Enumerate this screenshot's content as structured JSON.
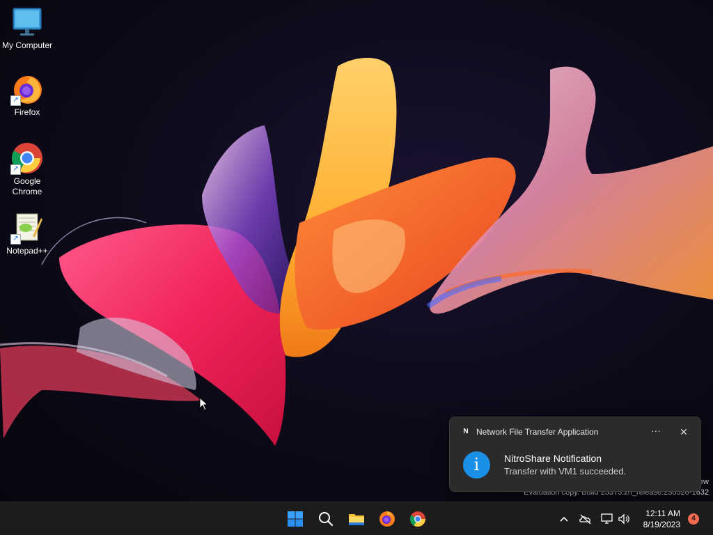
{
  "desktop": {
    "icons": [
      {
        "label": "My Computer",
        "icon": "computer-icon"
      },
      {
        "label": "Firefox",
        "icon": "firefox-icon"
      },
      {
        "label": "Google Chrome",
        "icon": "chrome-icon"
      },
      {
        "label": "Notepad++",
        "icon": "notepadpp-icon"
      }
    ],
    "watermark": {
      "line1": "ew",
      "line2": "Evaluation copy. Build 25375.zn_release.230520-1632"
    }
  },
  "notification": {
    "app_name": "Network File Transfer Application",
    "app_logo": "N",
    "more": "···",
    "close": "✕",
    "title": "NitroShare Notification",
    "body": "Transfer with VM1 succeeded.",
    "info_glyph": "i",
    "accent": "#1a8fe6"
  },
  "taskbar": {
    "apps": [
      "windows-start-icon",
      "search-icon",
      "file-explorer-icon",
      "firefox-icon",
      "chrome-icon"
    ],
    "tray": {
      "chevron": "^",
      "time": "12:11 AM",
      "date": "8/19/2023",
      "notification_count": "4"
    }
  }
}
